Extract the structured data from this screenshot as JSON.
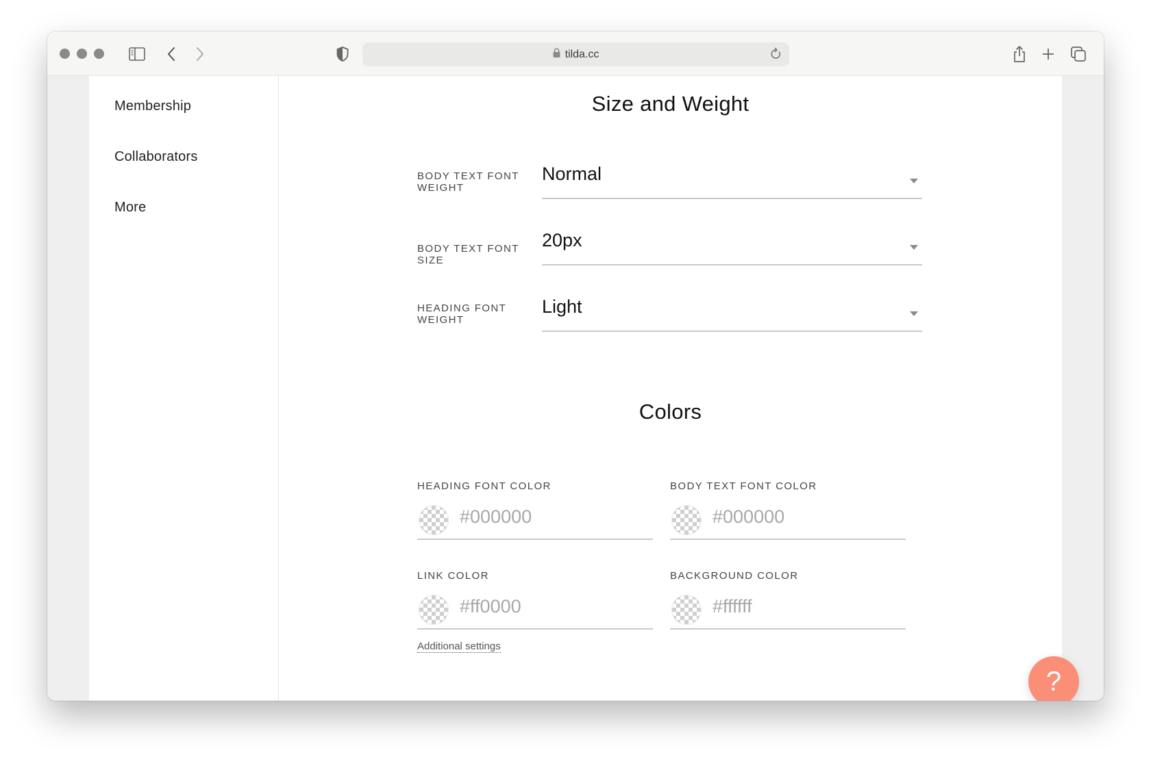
{
  "browser": {
    "url": "tilda.cc",
    "icons": {
      "traffic_lights": "window-control-dots",
      "sidebar": "sidebar-toggle-icon",
      "back": "chevron-left-icon",
      "forward": "chevron-right-icon",
      "privacy": "shield-icon",
      "lock": "lock-icon",
      "reload": "reload-icon",
      "share": "share-icon",
      "new_tab": "plus-icon",
      "tabs": "tab-overview-icon"
    }
  },
  "sidebar": {
    "items": [
      {
        "label": "Membership"
      },
      {
        "label": "Collaborators"
      },
      {
        "label": "More"
      }
    ]
  },
  "size_weight": {
    "title": "Size and Weight",
    "fields": [
      {
        "label": "Body text font weight",
        "value": "Normal"
      },
      {
        "label": "Body text font size",
        "value": "20px"
      },
      {
        "label": "Heading font weight",
        "value": "Light"
      }
    ]
  },
  "colors": {
    "title": "Colors",
    "fields": [
      {
        "label": "Heading font color",
        "value": "#000000"
      },
      {
        "label": "Body text font color",
        "value": "#000000"
      },
      {
        "label": "Link color",
        "value": "#ff0000"
      },
      {
        "label": "Background color",
        "value": "#ffffff"
      }
    ],
    "additional_settings": "Additional settings"
  },
  "help": {
    "label": "?",
    "color": "#fa8e77"
  }
}
